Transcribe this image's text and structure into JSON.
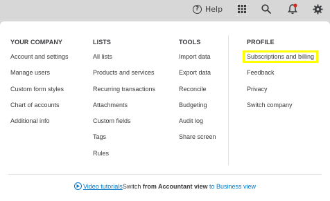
{
  "topbar": {
    "help_label": "Help",
    "help_icon_glyph": "?",
    "icons": [
      "help-icon",
      "apps-grid-icon",
      "search-icon",
      "notifications-bell-icon",
      "settings-gear-icon"
    ]
  },
  "columns": [
    {
      "heading": "YOUR COMPANY",
      "items": [
        "Account and settings",
        "Manage users",
        "Custom form styles",
        "Chart of accounts",
        "Additional info"
      ]
    },
    {
      "heading": "LISTS",
      "items": [
        "All lists",
        "Products and services",
        "Recurring transactions",
        "Attachments",
        "Custom fields",
        "Tags",
        "Rules"
      ]
    },
    {
      "heading": "TOOLS",
      "items": [
        "Import data",
        "Export data",
        "Reconcile",
        "Budgeting",
        "Audit log",
        "Share screen"
      ]
    },
    {
      "heading": "PROFILE",
      "items": [
        "Subscriptions and billing",
        "Feedback",
        "Privacy",
        "Switch company"
      ]
    }
  ],
  "footer": {
    "video_link": "Video tutorials",
    "switch_prefix": "Switch ",
    "switch_from": "from Accountant view",
    "switch_to": " to Business view"
  },
  "colors": {
    "link": "#0077c5",
    "highlight": "#ffff00",
    "notification_dot": "#d52b1e"
  }
}
